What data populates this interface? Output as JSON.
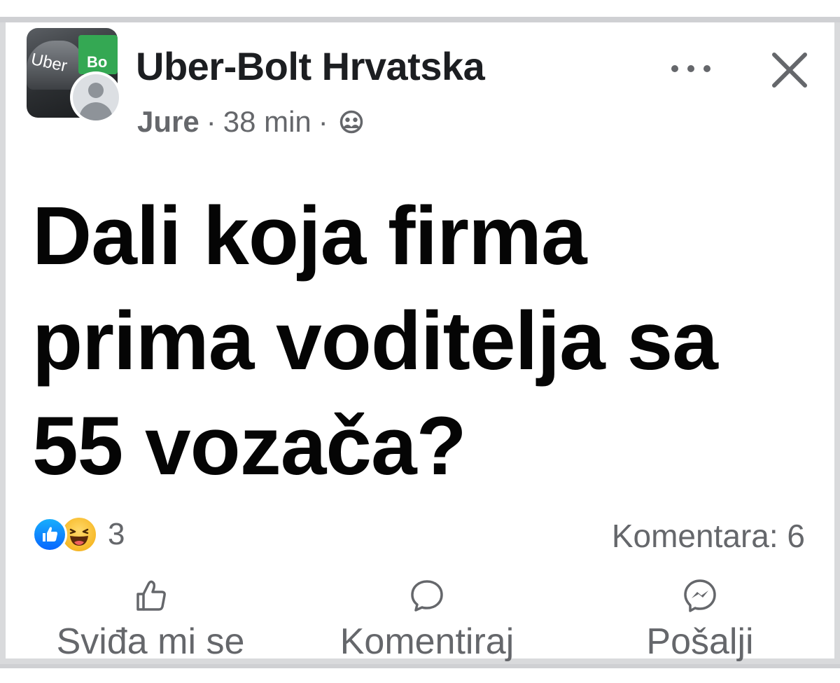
{
  "header": {
    "group_name": "Uber-Bolt Hrvatska",
    "author": "Jure",
    "separator": "·",
    "time": "38 min",
    "group_avatar_text": "Uber",
    "group_avatar_sign": "Bo"
  },
  "post": {
    "text": "Dali koja firma prima voditelja sa 55 vozača?"
  },
  "reactions": {
    "count": "3",
    "types": [
      "like-icon",
      "haha-icon"
    ]
  },
  "comments": {
    "label": "Komentara: 6"
  },
  "actions": {
    "like_label": "Sviđa mi se",
    "comment_label": "Komentiraj",
    "share_label": "Pošalji"
  },
  "colors": {
    "text_primary": "#050505",
    "text_secondary": "#65676b",
    "like_blue": "#0866ff",
    "haha_yellow": "#f7b928",
    "divider": "#cfd0d3"
  }
}
